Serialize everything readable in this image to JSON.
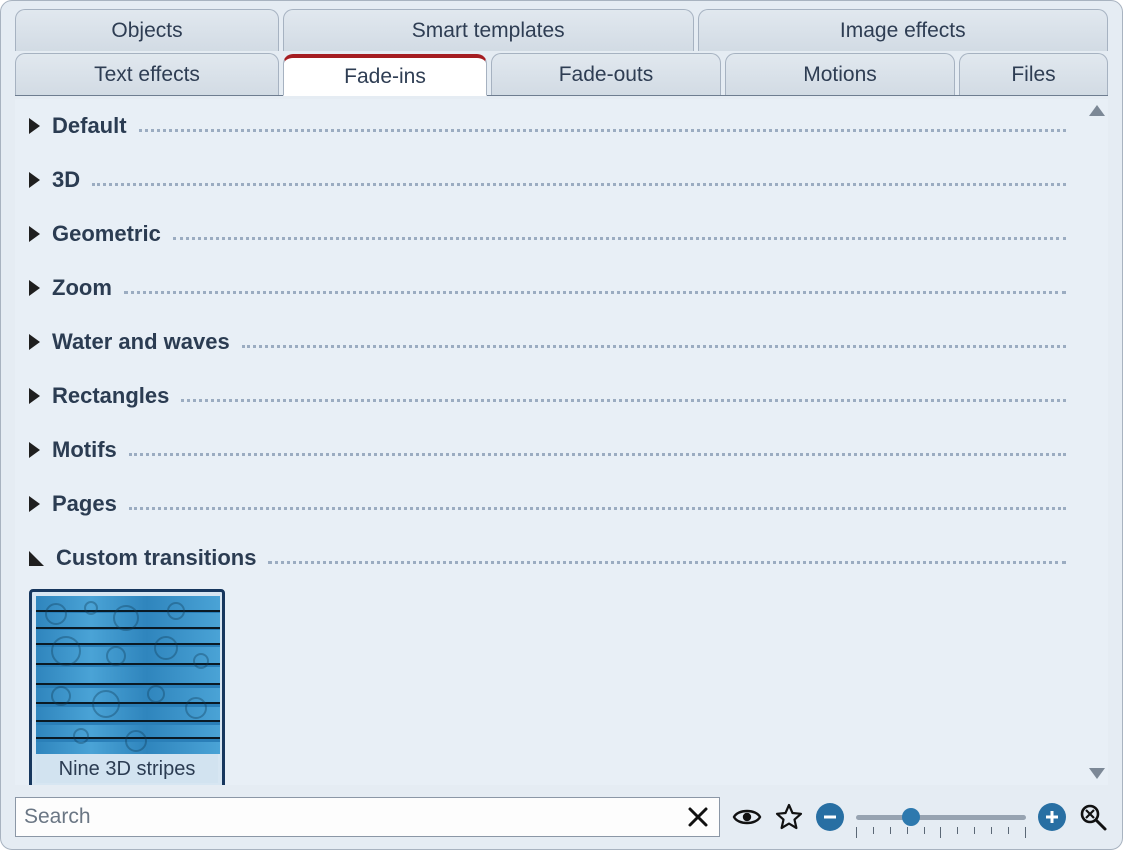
{
  "tabs_row1": [
    {
      "label": "Objects"
    },
    {
      "label": "Smart templates"
    },
    {
      "label": "Image effects"
    }
  ],
  "tabs_row2": [
    {
      "label": "Text effects",
      "active": false
    },
    {
      "label": "Fade-ins",
      "active": true
    },
    {
      "label": "Fade-outs",
      "active": false
    },
    {
      "label": "Motions",
      "active": false
    },
    {
      "label": "Files",
      "active": false
    }
  ],
  "categories": [
    {
      "label": "Default",
      "expanded": false
    },
    {
      "label": "3D",
      "expanded": false
    },
    {
      "label": "Geometric",
      "expanded": false
    },
    {
      "label": "Zoom",
      "expanded": false
    },
    {
      "label": "Water and waves",
      "expanded": false
    },
    {
      "label": "Rectangles",
      "expanded": false
    },
    {
      "label": "Motifs",
      "expanded": false
    },
    {
      "label": "Pages",
      "expanded": false
    },
    {
      "label": "Custom transitions",
      "expanded": true
    }
  ],
  "custom_transitions_items": [
    {
      "caption": "Nine 3D stripes"
    }
  ],
  "search": {
    "placeholder": "Search",
    "value": ""
  },
  "zoom": {
    "min": 0,
    "max": 10,
    "value": 3
  }
}
